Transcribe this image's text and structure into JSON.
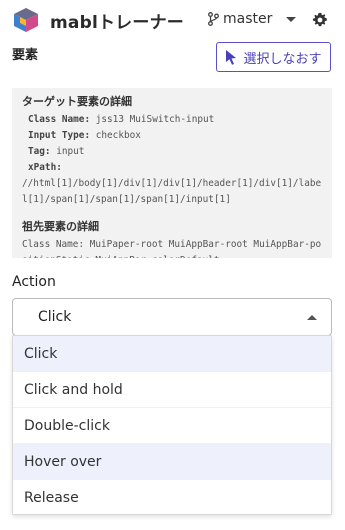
{
  "header": {
    "app_title": "mablトレーナー",
    "branch": "master",
    "logo_icon": "mabl-logo-icon",
    "branch_icon": "git-branch-icon",
    "settings_icon": "gear-icon"
  },
  "element_section": {
    "title": "要素",
    "reselect_label": "選択しなおす"
  },
  "details": {
    "target_heading": "ターゲット要素の詳細",
    "class_name_key": "Class Name:",
    "class_name_val": "jss13 MuiSwitch-input",
    "input_type_key": "Input Type:",
    "input_type_val": "checkbox",
    "tag_key": "Tag:",
    "tag_val": "input",
    "xpath_key": "xPath:",
    "xpath_val": "//html[1]/body[1]/div[1]/div[1]/header[1]/div[1]/label[1]/span[1]/span[1]/span[1]/input[1]",
    "ancestor_heading": "祖先要素の詳細",
    "anc_class_key": "Class Name:",
    "anc_class_val": "MuiPaper-root MuiAppBar-root MuiAppBar-positionStatic MuiAppBar-colorDefault"
  },
  "action": {
    "label": "Action",
    "selected": "Click",
    "options": [
      "Click",
      "Click and hold",
      "Double-click",
      "Hover over",
      "Release"
    ]
  },
  "colors": {
    "accent": "#5a4fcf",
    "menu_highlight": "#eef0fb",
    "details_bg": "#f2f2f2"
  }
}
